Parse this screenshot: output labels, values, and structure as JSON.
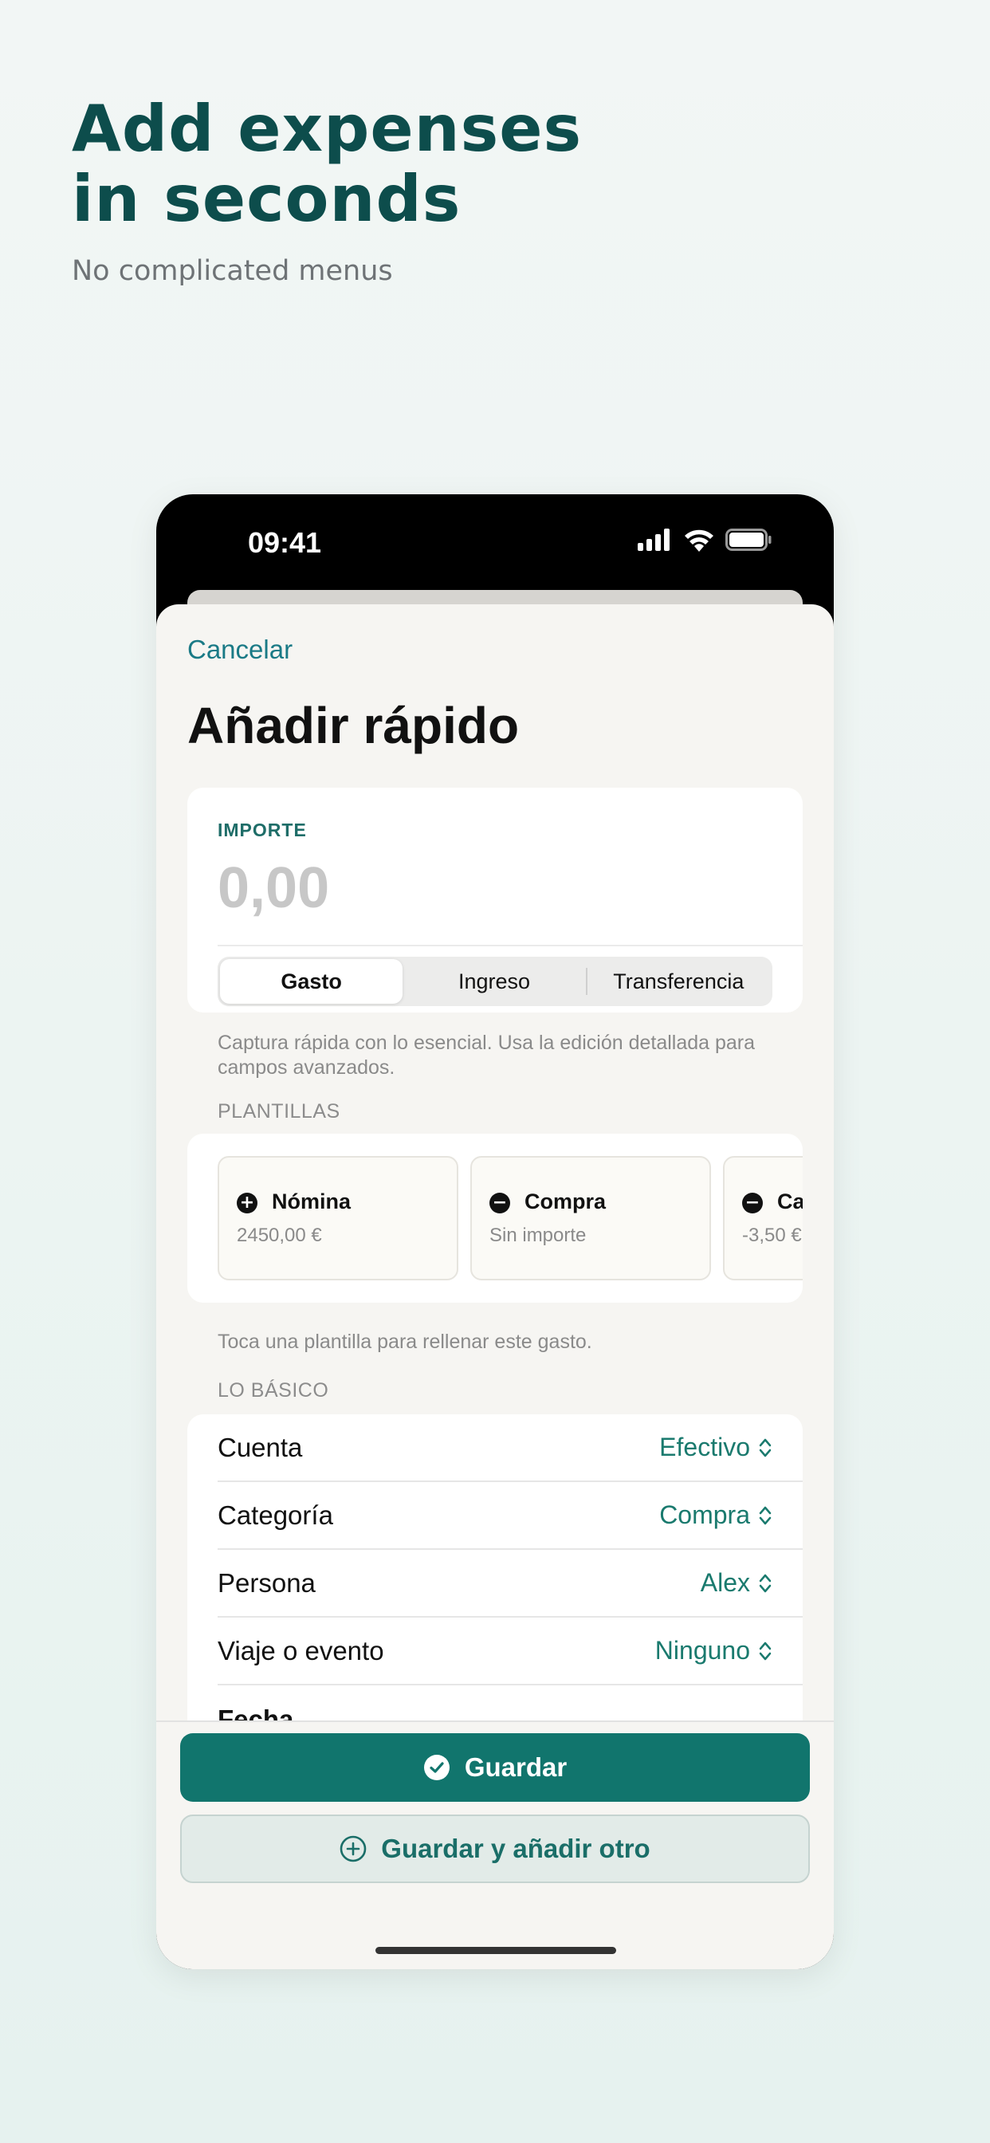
{
  "headline": {
    "line1": "Add expenses",
    "line2": "in seconds"
  },
  "subheadline": "No complicated menus",
  "status_bar": {
    "time": "09:41",
    "icons": [
      "signal-icon",
      "wifi-icon",
      "battery-icon"
    ]
  },
  "sheet": {
    "cancel_label": "Cancelar",
    "title": "Añadir rápido",
    "amount": {
      "label": "IMPORTE",
      "placeholder": "0,00"
    },
    "type_segments": [
      {
        "label": "Gasto",
        "selected": true
      },
      {
        "label": "Ingreso",
        "selected": false
      },
      {
        "label": "Transferencia",
        "selected": false
      }
    ],
    "helper_text": "Captura rápida con lo esencial. Usa la edición detallada para campos avanzados.",
    "templates": {
      "section_label": "PLANTILLAS",
      "items": [
        {
          "icon": "plus-circle-icon",
          "name": "Nómina",
          "detail": "2450,00 €"
        },
        {
          "icon": "minus-circle-icon",
          "name": "Compra",
          "detail": "Sin importe"
        },
        {
          "icon": "minus-circle-icon",
          "name": "Ca",
          "detail": "-3,50 €"
        }
      ],
      "helper_text": "Toca una plantilla para rellenar este gasto."
    },
    "basics": {
      "section_label": "LO BÁSICO",
      "rows": [
        {
          "label": "Cuenta",
          "value": "Efectivo"
        },
        {
          "label": "Categoría",
          "value": "Compra"
        },
        {
          "label": "Persona",
          "value": "Alex"
        },
        {
          "label": "Viaje o evento",
          "value": "Ninguno"
        }
      ],
      "partial_row_label": "Fecha"
    },
    "actions": {
      "save_label": "Guardar",
      "save_and_add_label": "Guardar y añadir otro"
    }
  },
  "colors": {
    "accent": "#11756d",
    "headline": "#0d4d4c",
    "link": "#1a7a86"
  }
}
